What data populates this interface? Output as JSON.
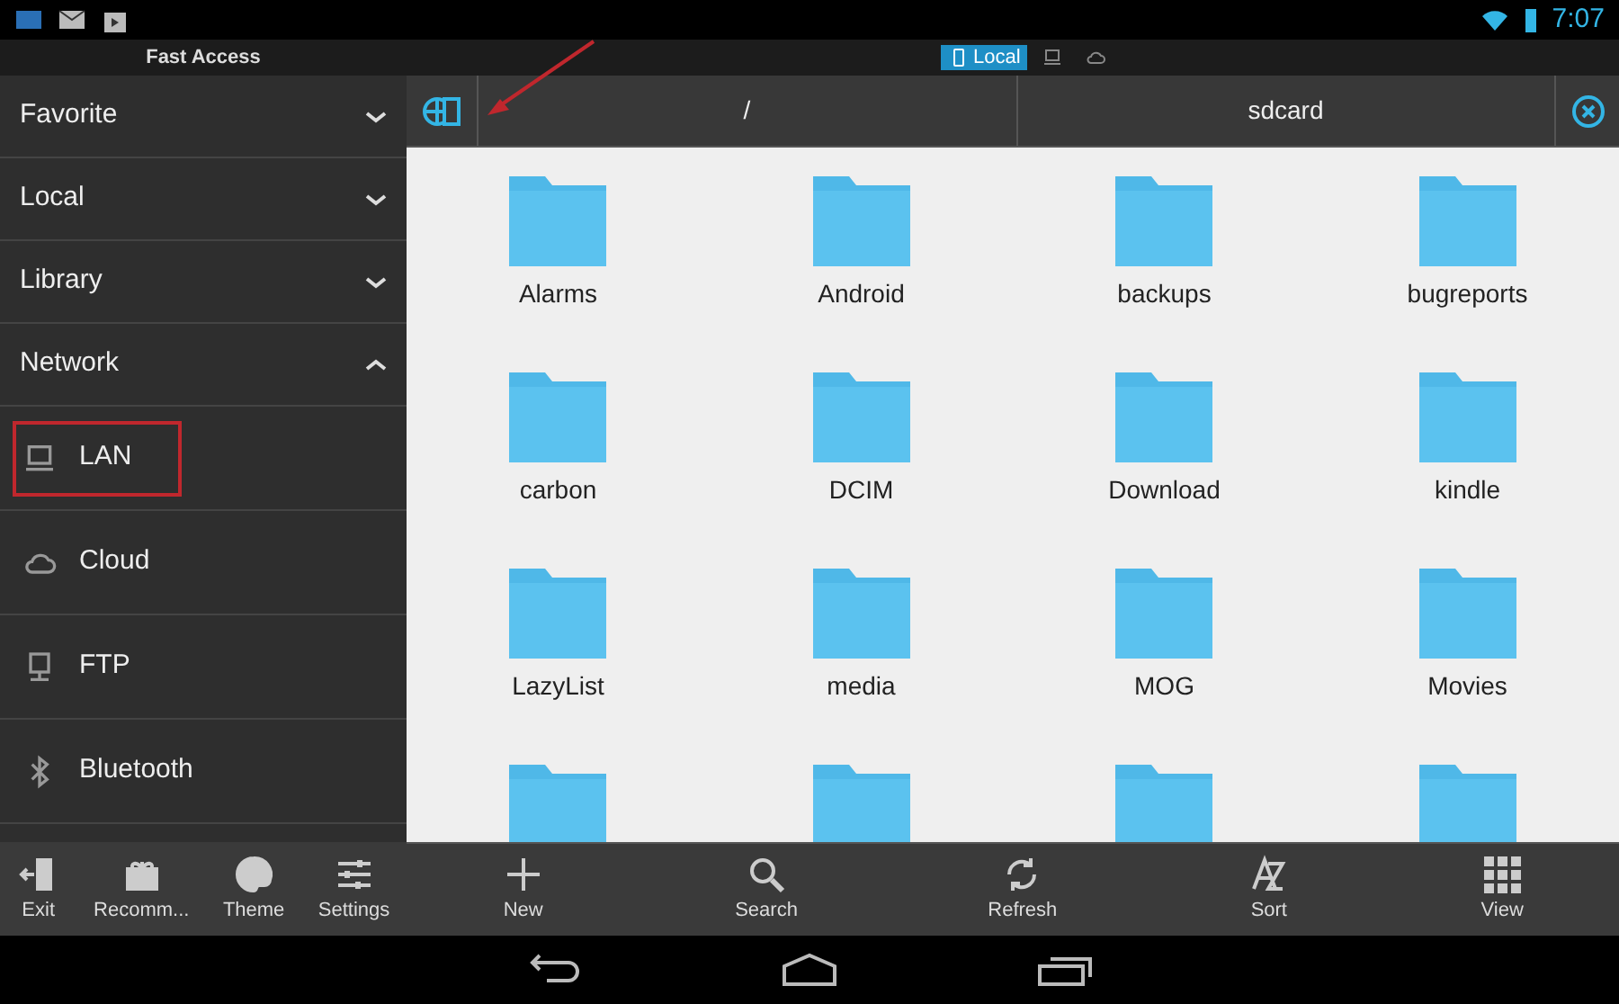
{
  "status_bar": {
    "time": "7:07"
  },
  "header": {
    "title": "Fast Access",
    "source_tabs": [
      {
        "kind": "device",
        "label": "Local",
        "selected": true
      },
      {
        "kind": "lan",
        "selected": false
      },
      {
        "kind": "cloud",
        "selected": false
      }
    ]
  },
  "sidebar": {
    "sections": [
      {
        "label": "Favorite",
        "expanded": false
      },
      {
        "label": "Local",
        "expanded": false
      },
      {
        "label": "Library",
        "expanded": false
      },
      {
        "label": "Network",
        "expanded": true,
        "children": [
          {
            "kind": "lan",
            "label": "LAN",
            "highlighted": true
          },
          {
            "kind": "cloud",
            "label": "Cloud",
            "highlighted": false
          },
          {
            "kind": "ftp",
            "label": "FTP",
            "highlighted": false
          },
          {
            "kind": "bluetooth",
            "label": "Bluetooth",
            "highlighted": false
          }
        ]
      }
    ],
    "toolbar": [
      {
        "kind": "exit",
        "label": "Exit"
      },
      {
        "kind": "gift",
        "label": "Recomm..."
      },
      {
        "kind": "theme",
        "label": "Theme"
      },
      {
        "kind": "settings",
        "label": "Settings"
      }
    ]
  },
  "path_bar": {
    "segments": [
      "/",
      "sdcard"
    ]
  },
  "folders": [
    {
      "kind": "folder",
      "name": "Alarms"
    },
    {
      "kind": "folder",
      "name": "Android"
    },
    {
      "kind": "folder",
      "name": "backups"
    },
    {
      "kind": "folder",
      "name": "bugreports"
    },
    {
      "kind": "folder",
      "name": "carbon"
    },
    {
      "kind": "folder",
      "name": "DCIM"
    },
    {
      "kind": "folder",
      "name": "Download"
    },
    {
      "kind": "folder",
      "name": "kindle"
    },
    {
      "kind": "folder",
      "name": "LazyList"
    },
    {
      "kind": "folder",
      "name": "media"
    },
    {
      "kind": "folder",
      "name": "MOG"
    },
    {
      "kind": "folder",
      "name": "Movies"
    },
    {
      "kind": "folder"
    },
    {
      "kind": "folder"
    },
    {
      "kind": "folder"
    },
    {
      "kind": "folder"
    }
  ],
  "toolbar": [
    {
      "kind": "new",
      "label": "New"
    },
    {
      "kind": "search",
      "label": "Search"
    },
    {
      "kind": "refresh",
      "label": "Refresh"
    },
    {
      "kind": "sort",
      "label": "Sort"
    },
    {
      "kind": "view",
      "label": "View"
    }
  ]
}
